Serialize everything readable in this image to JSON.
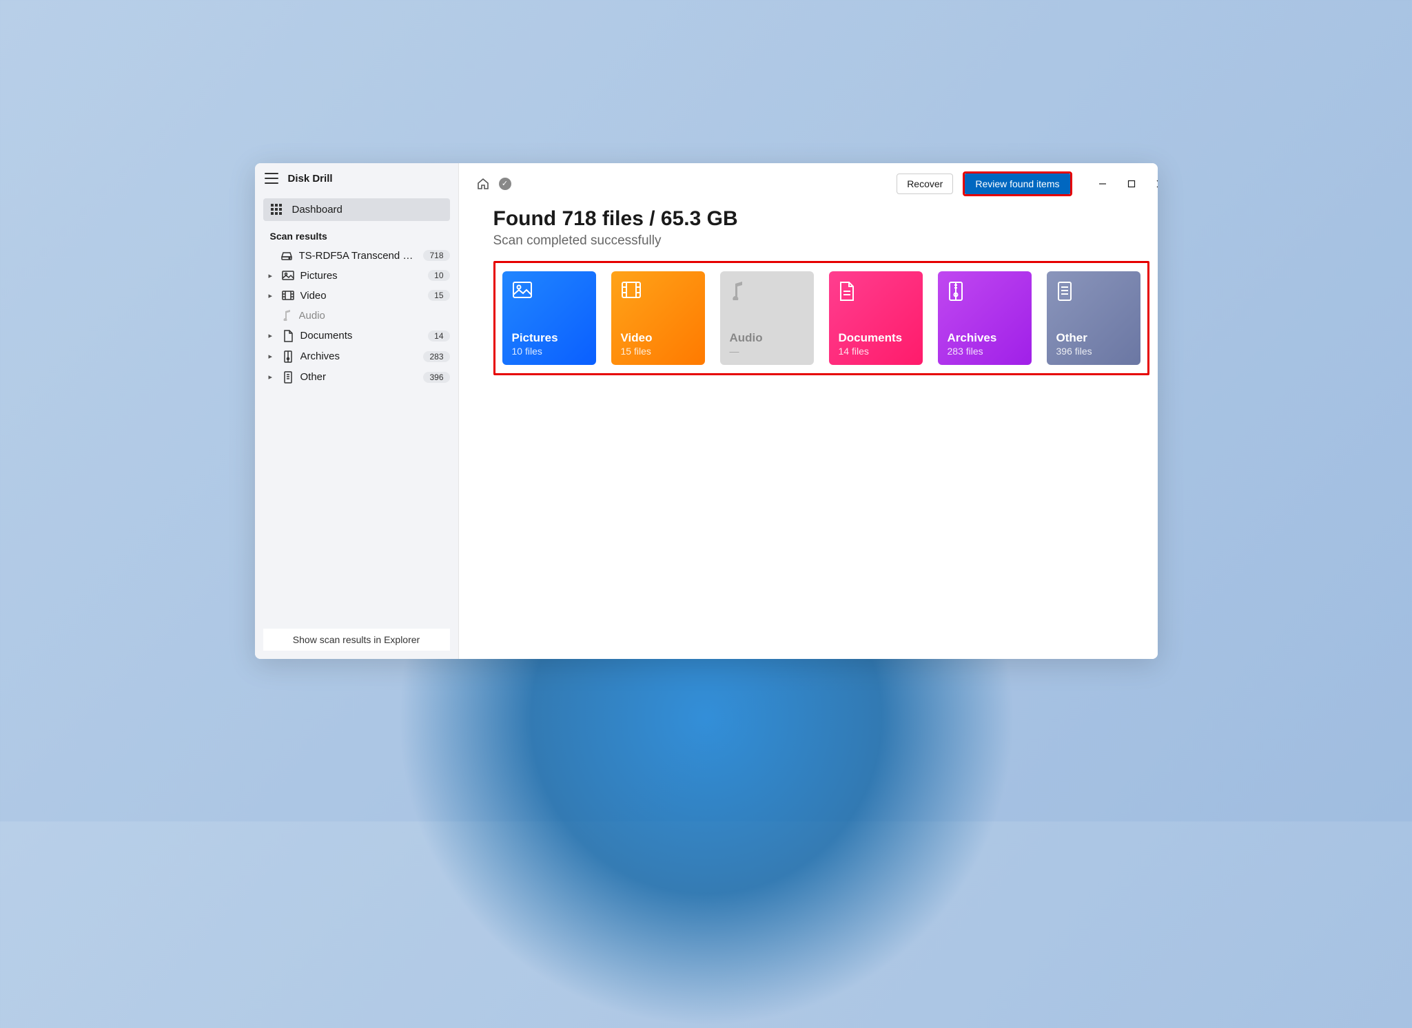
{
  "app": {
    "title": "Disk Drill"
  },
  "sidebar": {
    "dashboard": "Dashboard",
    "section": "Scan results",
    "device": {
      "label": "TS-RDF5A Transcend US...",
      "count": "718"
    },
    "items": [
      {
        "label": "Pictures",
        "count": "10"
      },
      {
        "label": "Video",
        "count": "15"
      },
      {
        "label": "Audio",
        "count": ""
      },
      {
        "label": "Documents",
        "count": "14"
      },
      {
        "label": "Archives",
        "count": "283"
      },
      {
        "label": "Other",
        "count": "396"
      }
    ],
    "footer": "Show scan results in Explorer"
  },
  "toolbar": {
    "recover": "Recover",
    "review": "Review found items"
  },
  "main": {
    "heading": "Found 718 files / 65.3 GB",
    "subheading": "Scan completed successfully"
  },
  "tiles": [
    {
      "title": "Pictures",
      "sub": "10 files"
    },
    {
      "title": "Video",
      "sub": "15 files"
    },
    {
      "title": "Audio",
      "sub": "—"
    },
    {
      "title": "Documents",
      "sub": "14 files"
    },
    {
      "title": "Archives",
      "sub": "283 files"
    },
    {
      "title": "Other",
      "sub": "396 files"
    }
  ]
}
